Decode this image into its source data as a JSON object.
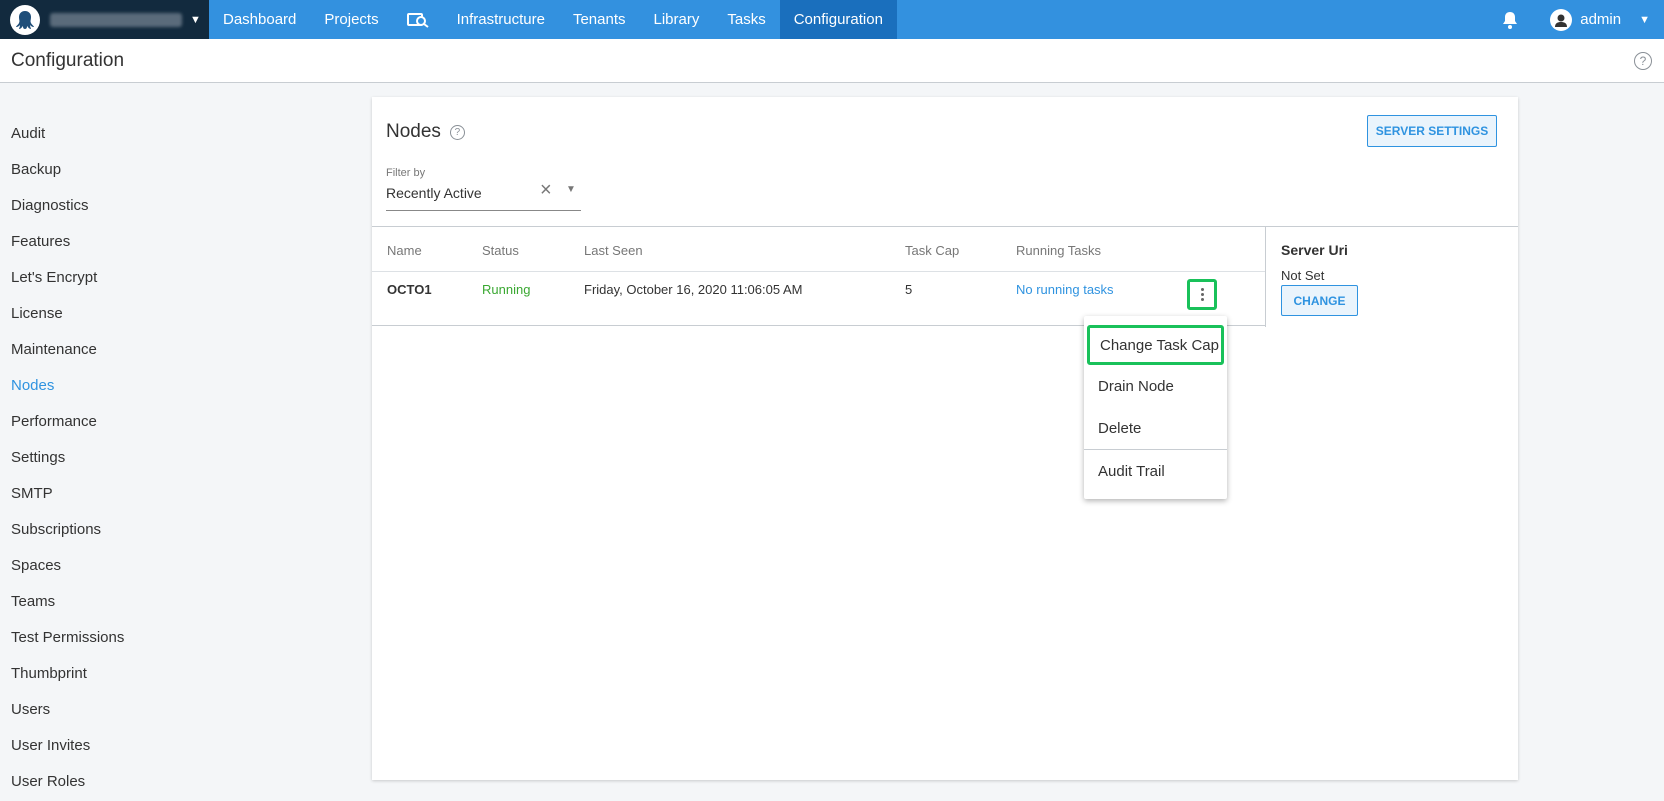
{
  "nav": {
    "items": [
      "Dashboard",
      "Projects",
      "Infrastructure",
      "Tenants",
      "Library",
      "Tasks",
      "Configuration"
    ],
    "user": "admin"
  },
  "page": {
    "title": "Configuration",
    "help": "?"
  },
  "sidebar": {
    "items": [
      "Audit",
      "Backup",
      "Diagnostics",
      "Features",
      "Let's Encrypt",
      "License",
      "Maintenance",
      "Nodes",
      "Performance",
      "Settings",
      "SMTP",
      "Subscriptions",
      "Spaces",
      "Teams",
      "Test Permissions",
      "Thumbprint",
      "Users",
      "User Invites",
      "User Roles"
    ],
    "active": "Nodes"
  },
  "panel": {
    "title": "Nodes",
    "server_settings": "SERVER SETTINGS",
    "filter": {
      "label": "Filter by",
      "value": "Recently Active"
    },
    "columns": [
      "Name",
      "Status",
      "Last Seen",
      "Task Cap",
      "Running Tasks"
    ],
    "rows": [
      {
        "name": "OCTO1",
        "status": "Running",
        "last_seen": "Friday, October 16, 2020 11:06:05 AM",
        "task_cap": "5",
        "running_tasks": "No running tasks"
      }
    ],
    "server_uri": {
      "title": "Server Uri",
      "value": "Not Set",
      "change": "CHANGE"
    }
  },
  "menu": {
    "items": [
      "Change Task Cap",
      "Drain Node",
      "Delete",
      "Audit Trail"
    ]
  },
  "colors": {
    "nav": "#3391df",
    "accent": "#2f93e0",
    "running": "#3aa832",
    "highlight": "#19c15a"
  }
}
